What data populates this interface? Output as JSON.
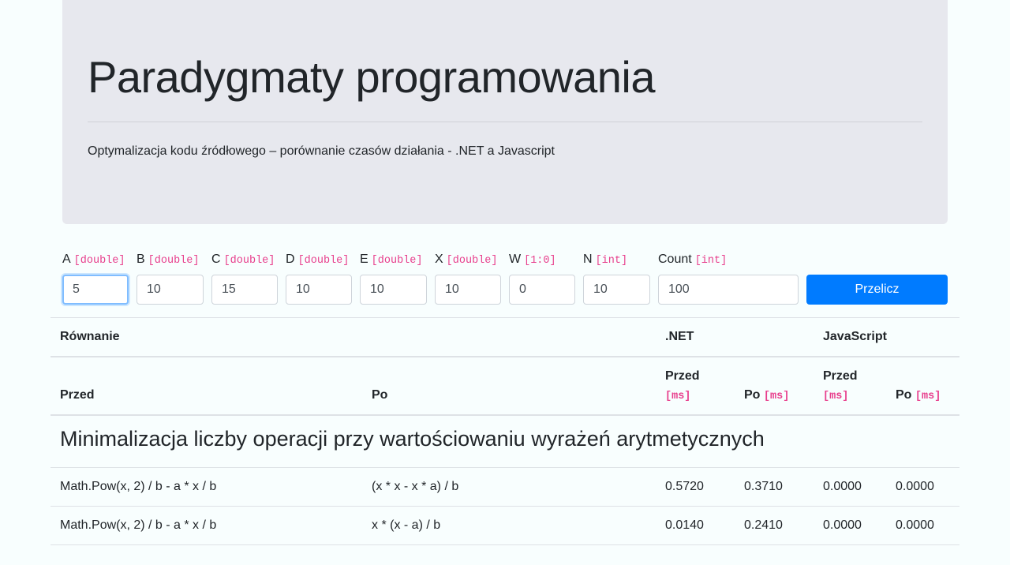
{
  "header": {
    "title": "Paradygmaty programowania",
    "subtitle": "Optymalizacja kodu źródłowego – porównanie czasów działania - .NET a Javascript"
  },
  "form": {
    "fields": [
      {
        "label": "A",
        "type": "[double]",
        "value": "5"
      },
      {
        "label": "B",
        "type": "[double]",
        "value": "10"
      },
      {
        "label": "C",
        "type": "[double]",
        "value": "15"
      },
      {
        "label": "D",
        "type": "[double]",
        "value": "10"
      },
      {
        "label": "E",
        "type": "[double]",
        "value": "10"
      },
      {
        "label": "X",
        "type": "[double]",
        "value": "10"
      },
      {
        "label": "W",
        "type": "[1:0]",
        "value": "0"
      },
      {
        "label": "N",
        "type": "[int]",
        "value": "10"
      },
      {
        "label": "Count",
        "type": "[int]",
        "value": "100"
      }
    ],
    "submit_label": "Przelicz"
  },
  "table": {
    "group_headers": {
      "equation": "Równanie",
      "net": ".NET",
      "js": "JavaScript"
    },
    "sub_headers": {
      "before": "Przed",
      "after": "Po",
      "net_before": "Przed",
      "net_after": "Po",
      "js_before": "Przed",
      "js_after": "Po",
      "unit": "[ms]"
    },
    "section_title": "Minimalizacja liczby operacji przy wartościowaniu wyrażeń arytmetycznych",
    "rows": [
      {
        "before": "Math.Pow(x, 2) / b - a * x / b",
        "after": "(x * x - x * a) / b",
        "net_before": "0.5720",
        "net_after": "0.3710",
        "js_before": "0.0000",
        "js_after": "0.0000"
      },
      {
        "before": "Math.Pow(x, 2) / b - a * x / b",
        "after": "x * (x - a) / b",
        "net_before": "0.0140",
        "net_after": "0.2410",
        "js_before": "0.0000",
        "js_after": "0.0000"
      }
    ]
  }
}
